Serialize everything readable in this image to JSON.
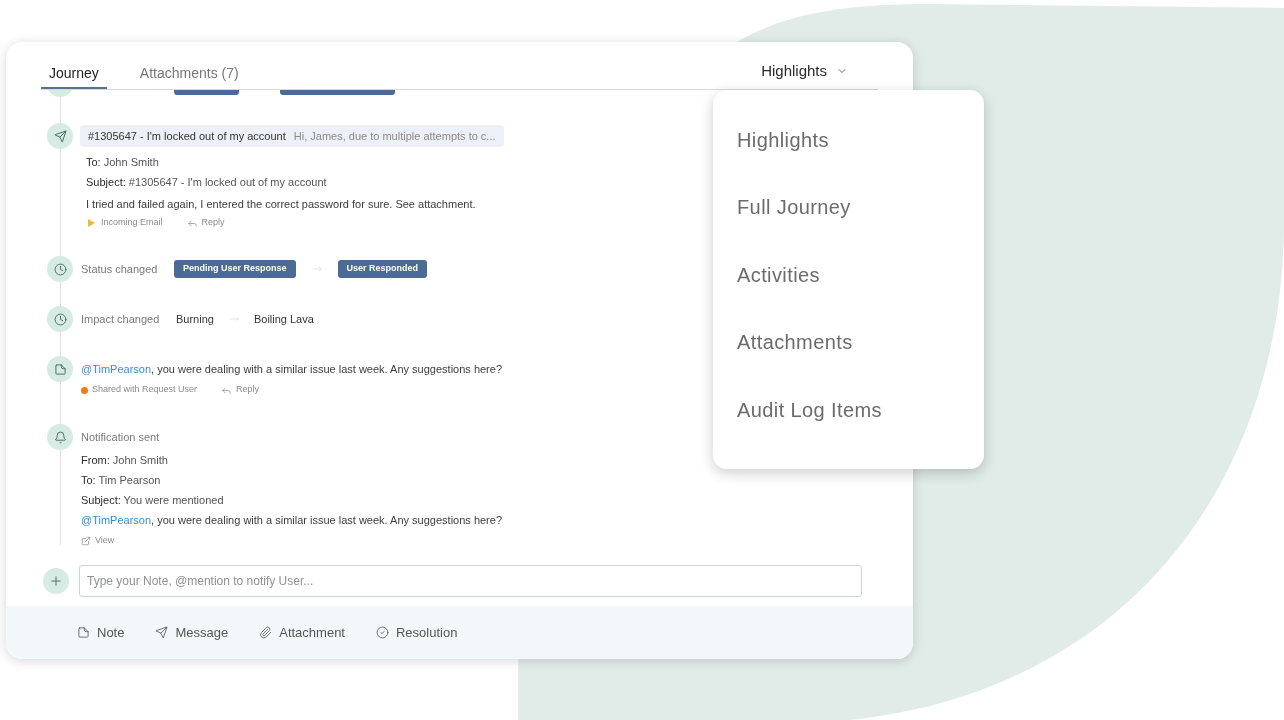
{
  "tabs": [
    {
      "label": "Journey",
      "selected": true
    },
    {
      "label": "Attachments (7)",
      "selected": false
    }
  ],
  "view_selector": {
    "label": "Highlights",
    "expanded": true,
    "options": [
      "Highlights",
      "Full Journey",
      "Activities",
      "Attachments",
      "Audit Log Items"
    ]
  },
  "timeline": [
    {
      "kind": "email",
      "subject_line": "#1305647 - I'm locked out of my account",
      "preview": "Hi, James, due to multiple attempts to c...",
      "fields": [
        {
          "label": "To:",
          "value": "John Smith"
        },
        {
          "label": "Subject:",
          "value": "#1305647 - I'm locked out of my account"
        }
      ],
      "body": "I tried and failed again, I entered the correct password for sure. See attachment.",
      "source": "Incoming Email",
      "action": "Reply"
    },
    {
      "kind": "status_change",
      "label": "Status changed",
      "from": "Pending User Response",
      "to": "User Responded"
    },
    {
      "kind": "impact_change",
      "label": "Impact changed",
      "from": "Burning",
      "to": "Boiling Lava"
    },
    {
      "kind": "note",
      "mention": "@TimPearson",
      "text": ", you were dealing with a similar issue last week. Any suggestions here?",
      "visibility": "Shared with Request User",
      "action": "Reply"
    },
    {
      "kind": "notification",
      "label": "Notification sent",
      "fields": [
        {
          "label": "From:",
          "value": "John Smith"
        },
        {
          "label": "To:",
          "value": "Tim Pearson"
        },
        {
          "label": "Subject:",
          "value": "You were mentioned"
        }
      ],
      "mention": "@TimPearson",
      "text": ", you were dealing with a similar issue last week. Any suggestions here?",
      "action": "View"
    }
  ],
  "note_input": {
    "placeholder": "Type your Note, @mention to notify User..."
  },
  "footer_actions": [
    {
      "kind": "note",
      "label": "Note"
    },
    {
      "kind": "message",
      "label": "Message"
    },
    {
      "kind": "attachment",
      "label": "Attachment"
    },
    {
      "kind": "resolution",
      "label": "Resolution"
    }
  ]
}
